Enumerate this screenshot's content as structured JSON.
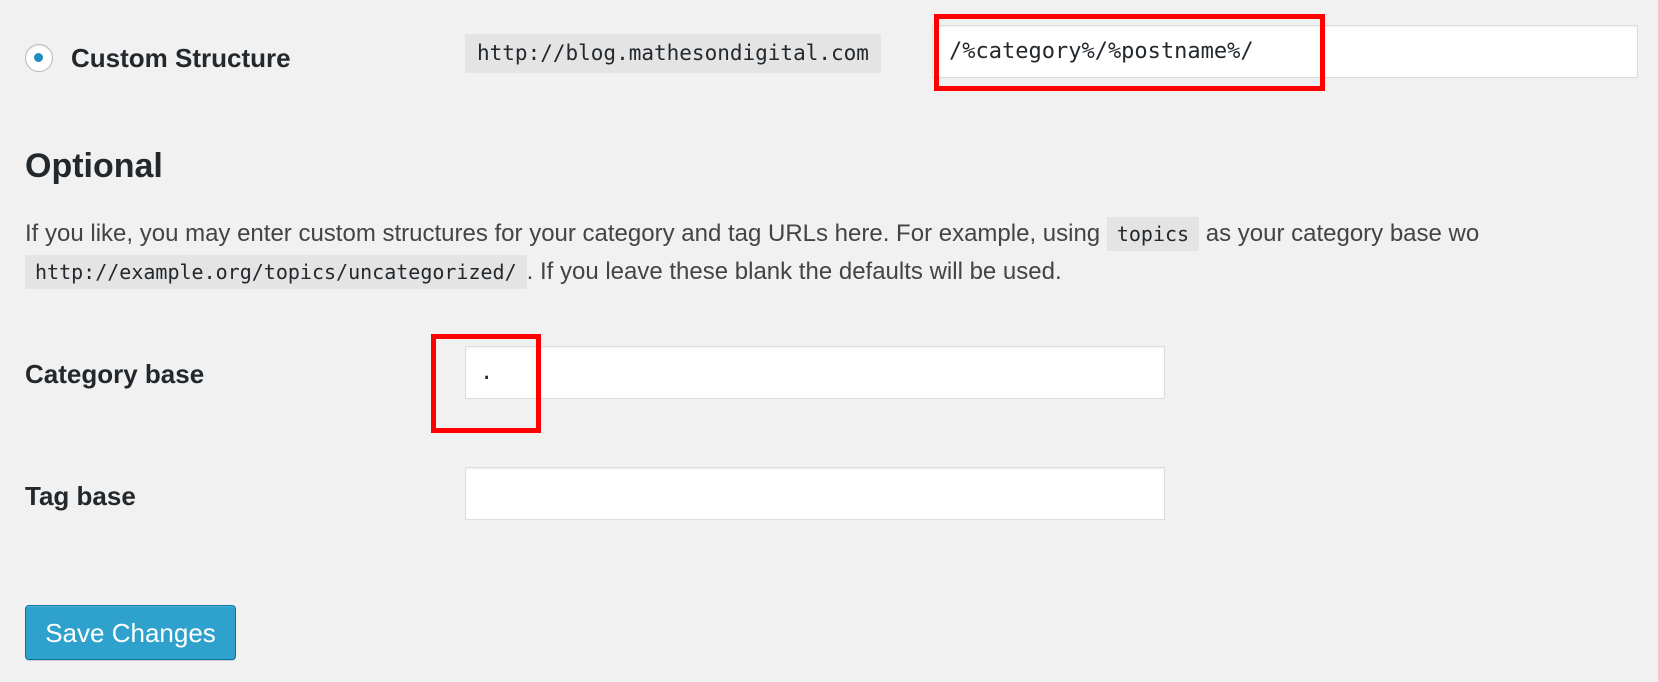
{
  "custom_structure": {
    "radio_selected": true,
    "label": "Custom Structure",
    "url_prefix": "http://blog.mathesondigital.com",
    "value": "/%category%/%postname%/"
  },
  "optional": {
    "title": "Optional",
    "description": {
      "part1": "If you like, you may enter custom structures for your category and tag URLs here. For example, using ",
      "code1": "topics",
      "part2": " as your category base wo",
      "code2": "http://example.org/topics/uncategorized/",
      "part3": ". If you leave these blank the defaults will be used."
    }
  },
  "category_base": {
    "label": "Category base",
    "value": "."
  },
  "tag_base": {
    "label": "Tag base",
    "value": ""
  },
  "actions": {
    "save_label": "Save Changes"
  },
  "colors": {
    "accent": "#2ea2cc",
    "radio_dot": "#1e8cbe",
    "highlight": "#ff0000",
    "background": "#f1f1f1"
  }
}
